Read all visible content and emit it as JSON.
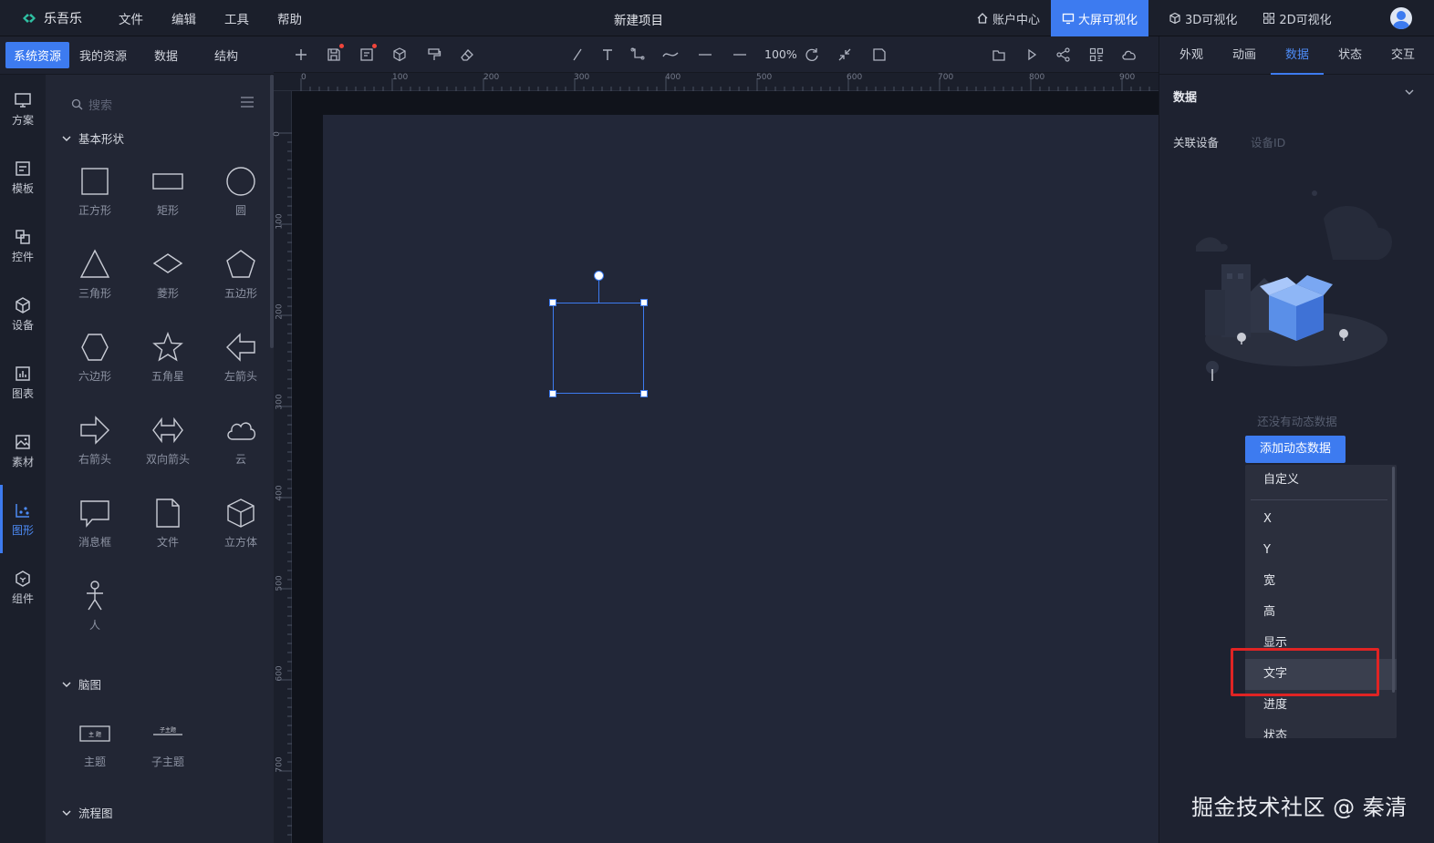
{
  "app": {
    "logo_text": "乐吾乐",
    "menu": [
      "文件",
      "编辑",
      "工具",
      "帮助"
    ],
    "project_title": "新建项目",
    "top_tabs": [
      {
        "label": "账户中心",
        "icon": "home-icon",
        "active": false
      },
      {
        "label": "大屏可视化",
        "icon": "monitor-icon",
        "active": true
      },
      {
        "label": "3D可视化",
        "icon": "cube-icon",
        "active": false
      },
      {
        "label": "2D可视化",
        "icon": "grid-icon",
        "active": false
      }
    ],
    "accent": "#3d7bf0"
  },
  "left_tabs": [
    {
      "label": "系统资源",
      "active": true
    },
    {
      "label": "我的资源",
      "active": false
    },
    {
      "label": "数据",
      "active": false
    },
    {
      "label": "结构",
      "active": false
    }
  ],
  "rail": [
    {
      "label": "方案",
      "icon": "monitor-icon"
    },
    {
      "label": "模板",
      "icon": "template-icon"
    },
    {
      "label": "控件",
      "icon": "widget-icon"
    },
    {
      "label": "设备",
      "icon": "device-cube-icon"
    },
    {
      "label": "图表",
      "icon": "chart-icon"
    },
    {
      "label": "素材",
      "icon": "image-icon"
    },
    {
      "label": "图形",
      "icon": "shapes-icon",
      "active": true
    },
    {
      "label": "组件",
      "icon": "component-icon"
    }
  ],
  "shapes_panel": {
    "search_placeholder": "搜索",
    "section_basic": "基本形状",
    "basic_shapes": [
      {
        "label": "正方形",
        "icon": "square-icon"
      },
      {
        "label": "矩形",
        "icon": "rectangle-icon"
      },
      {
        "label": "圆",
        "icon": "circle-icon"
      },
      {
        "label": "三角形",
        "icon": "triangle-icon"
      },
      {
        "label": "菱形",
        "icon": "diamond-icon"
      },
      {
        "label": "五边形",
        "icon": "pentagon-icon"
      },
      {
        "label": "六边形",
        "icon": "hexagon-icon"
      },
      {
        "label": "五角星",
        "icon": "star-icon"
      },
      {
        "label": "左箭头",
        "icon": "left-arrow-icon"
      },
      {
        "label": "右箭头",
        "icon": "right-arrow-icon"
      },
      {
        "label": "双向箭头",
        "icon": "double-arrow-icon"
      },
      {
        "label": "云",
        "icon": "cloud-icon"
      },
      {
        "label": "消息框",
        "icon": "message-box-icon"
      },
      {
        "label": "文件",
        "icon": "file-icon"
      },
      {
        "label": "立方体",
        "icon": "cube-icon"
      },
      {
        "label": "人",
        "icon": "person-icon"
      }
    ],
    "section_mind": "脑图",
    "mind_shapes": [
      {
        "label": "主题",
        "icon": "topic-icon",
        "inner": "主 题"
      },
      {
        "label": "子主题",
        "icon": "subtopic-icon",
        "inner": "子主题"
      }
    ],
    "section_flow": "流程图"
  },
  "toolbar": {
    "zoom": "100%"
  },
  "ruler": {
    "top_ticks": [
      "0",
      "100",
      "200",
      "300",
      "400",
      "500",
      "600",
      "700",
      "800",
      "900"
    ],
    "left_ticks": [
      "0",
      "100",
      "200",
      "300",
      "400",
      "500",
      "600",
      "700"
    ]
  },
  "right_panel": {
    "tabs": [
      {
        "label": "外观",
        "active": false
      },
      {
        "label": "动画",
        "active": false
      },
      {
        "label": "数据",
        "active": true
      },
      {
        "label": "状态",
        "active": false
      },
      {
        "label": "交互",
        "active": false
      }
    ],
    "section_title": "数据",
    "device_label": "关联设备",
    "device_placeholder": "设备ID",
    "empty_text": "还没有动态数据",
    "add_button": "添加动态数据",
    "dropdown_items": [
      "自定义",
      "X",
      "Y",
      "宽",
      "高",
      "显示",
      "文字",
      "进度",
      "状态"
    ],
    "selected_item": "文字"
  },
  "watermark": "掘金技术社区 @ 秦清"
}
